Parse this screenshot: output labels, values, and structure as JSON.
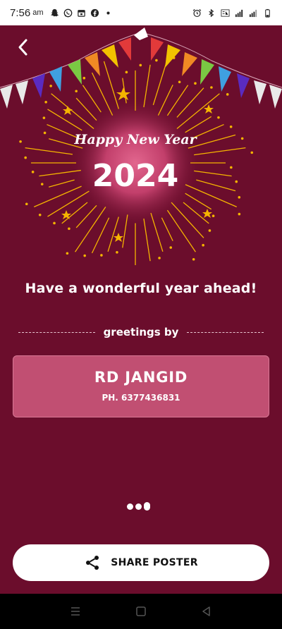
{
  "status_bar": {
    "time": "7:56",
    "ampm": "am",
    "left_icons": [
      "snapchat-icon",
      "whatsapp-icon",
      "calendar-icon",
      "facebook-icon",
      "dot-icon"
    ],
    "right_icons": [
      "alarm-icon",
      "bluetooth-icon",
      "volte-icon",
      "lte-signal-icon",
      "signal-icon",
      "battery-icon"
    ]
  },
  "poster": {
    "script_title": "Happy New Year",
    "year": "2024",
    "colors": {
      "background": "#6b0d2c",
      "burst_glow": "#d9557f",
      "rays": "#f5b400"
    }
  },
  "greeting_text": "Have a wonderful year ahead!",
  "greetings_by_label": "greetings by",
  "card": {
    "name": "RD JANGID",
    "phone": "PH. 6377436831"
  },
  "pager": {
    "count": 3,
    "active_index": 2
  },
  "share": {
    "label": "SHARE POSTER"
  }
}
